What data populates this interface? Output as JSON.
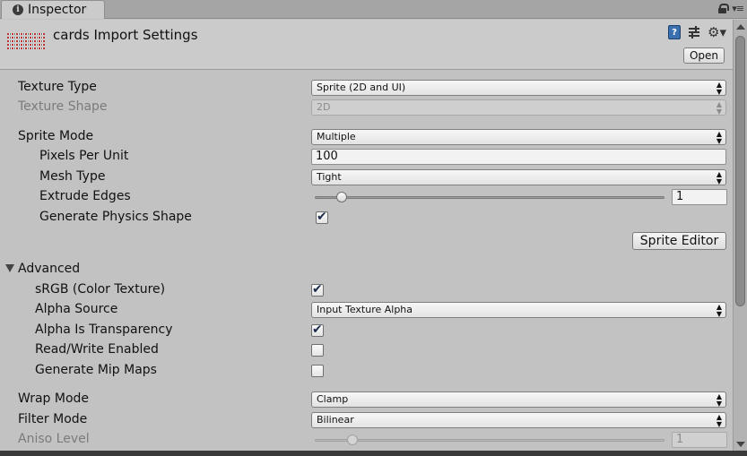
{
  "tab": {
    "label": "Inspector",
    "icon": "info-icon",
    "menu_glyph": "▾≡"
  },
  "header": {
    "title": "cards Import Settings",
    "open_label": "Open"
  },
  "fields": {
    "texture_type": {
      "label": "Texture Type",
      "value": "Sprite (2D and UI)"
    },
    "texture_shape": {
      "label": "Texture Shape",
      "value": "2D"
    },
    "sprite_mode": {
      "label": "Sprite Mode",
      "value": "Multiple"
    },
    "pixels_per_unit": {
      "label": "Pixels Per Unit",
      "value": "100"
    },
    "mesh_type": {
      "label": "Mesh Type",
      "value": "Tight"
    },
    "extrude_edges": {
      "label": "Extrude Edges",
      "value": "1",
      "min": 0,
      "max": 32
    },
    "generate_physics_shape": {
      "label": "Generate Physics Shape",
      "checked": true
    },
    "sprite_editor_label": "Sprite Editor",
    "advanced": {
      "label": "Advanced",
      "expanded": true
    },
    "srgb": {
      "label": "sRGB (Color Texture)",
      "checked": true
    },
    "alpha_source": {
      "label": "Alpha Source",
      "value": "Input Texture Alpha"
    },
    "alpha_is_transparency": {
      "label": "Alpha Is Transparency",
      "checked": true
    },
    "read_write": {
      "label": "Read/Write Enabled",
      "checked": false
    },
    "generate_mip_maps": {
      "label": "Generate Mip Maps",
      "checked": false
    },
    "wrap_mode": {
      "label": "Wrap Mode",
      "value": "Clamp"
    },
    "filter_mode": {
      "label": "Filter Mode",
      "value": "Bilinear"
    },
    "aniso_level": {
      "label": "Aniso Level",
      "value": "1",
      "min": 0,
      "max": 16
    }
  },
  "colors": {
    "panel": "#c2c2c2",
    "header": "#cbcbcb",
    "help_icon": "#3a6fb0",
    "disabled_text": "#7b7b7b"
  }
}
